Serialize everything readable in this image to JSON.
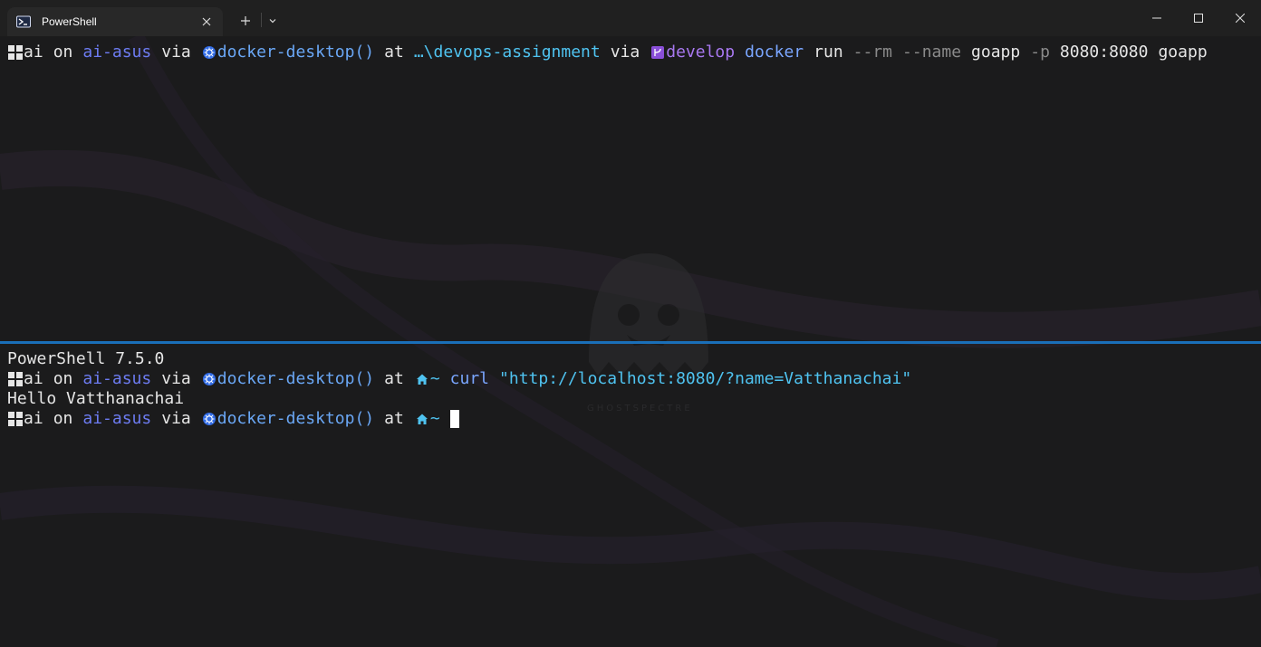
{
  "window": {
    "tab_title": "PowerShell",
    "icons": {
      "tab": "powershell-icon",
      "close": "close-icon",
      "new_tab": "plus-icon",
      "dropdown": "chevron-down-icon",
      "minimize": "minimize-icon",
      "maximize": "maximize-icon",
      "window_close": "close-icon"
    }
  },
  "top_pane": {
    "prompt": {
      "user": "ai",
      "on": "on",
      "host": "ai-asus",
      "via": "via",
      "context": "docker-desktop()",
      "at": "at",
      "path": "…\\devops-assignment",
      "via2": "via",
      "branch": "develop"
    },
    "command": {
      "cmd": "docker",
      "arg1": "run",
      "flag1": "--rm",
      "flag2": "--name",
      "arg2": "goapp",
      "flag3": "-p",
      "arg3": "8080:8080",
      "arg4": "goapp"
    }
  },
  "bottom_pane": {
    "banner": "PowerShell 7.5.0",
    "prompt1": {
      "user": "ai",
      "on": "on",
      "host": "ai-asus",
      "via": "via",
      "context": "docker-desktop()",
      "at": "at",
      "path": "~"
    },
    "command": {
      "cmd": "curl",
      "arg": "\"http://localhost:8080/?name=Vatthanachai\""
    },
    "output": "Hello Vatthanachai",
    "prompt2": {
      "user": "ai",
      "on": "on",
      "host": "ai-asus",
      "via": "via",
      "context": "docker-desktop()",
      "at": "at",
      "path": "~"
    }
  },
  "watermark": {
    "text": "GHOSTSPECTRE"
  },
  "colors": {
    "accent_divider": "#1a6fb8",
    "host": "#6d7cf2",
    "path": "#4fc3f0",
    "branch": "#a878f0"
  }
}
